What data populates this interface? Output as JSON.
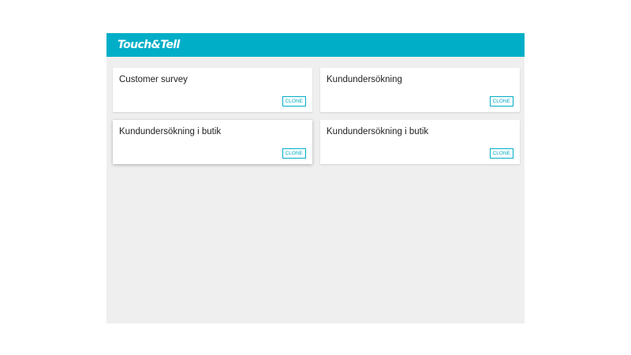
{
  "header": {
    "logo_text": "Touch&Tell"
  },
  "surveys": [
    {
      "title": "Customer survey",
      "clone_label": "CLONE"
    },
    {
      "title": "Kundundersökning",
      "clone_label": "CLONE"
    },
    {
      "title": "Kundundersökning i butik",
      "clone_label": "CLONE"
    },
    {
      "title": "Kundundersökning i butik",
      "clone_label": "CLONE"
    }
  ],
  "colors": {
    "brand": "#00aec7",
    "content_background": "#eeefee",
    "card_background": "#ffffff"
  }
}
